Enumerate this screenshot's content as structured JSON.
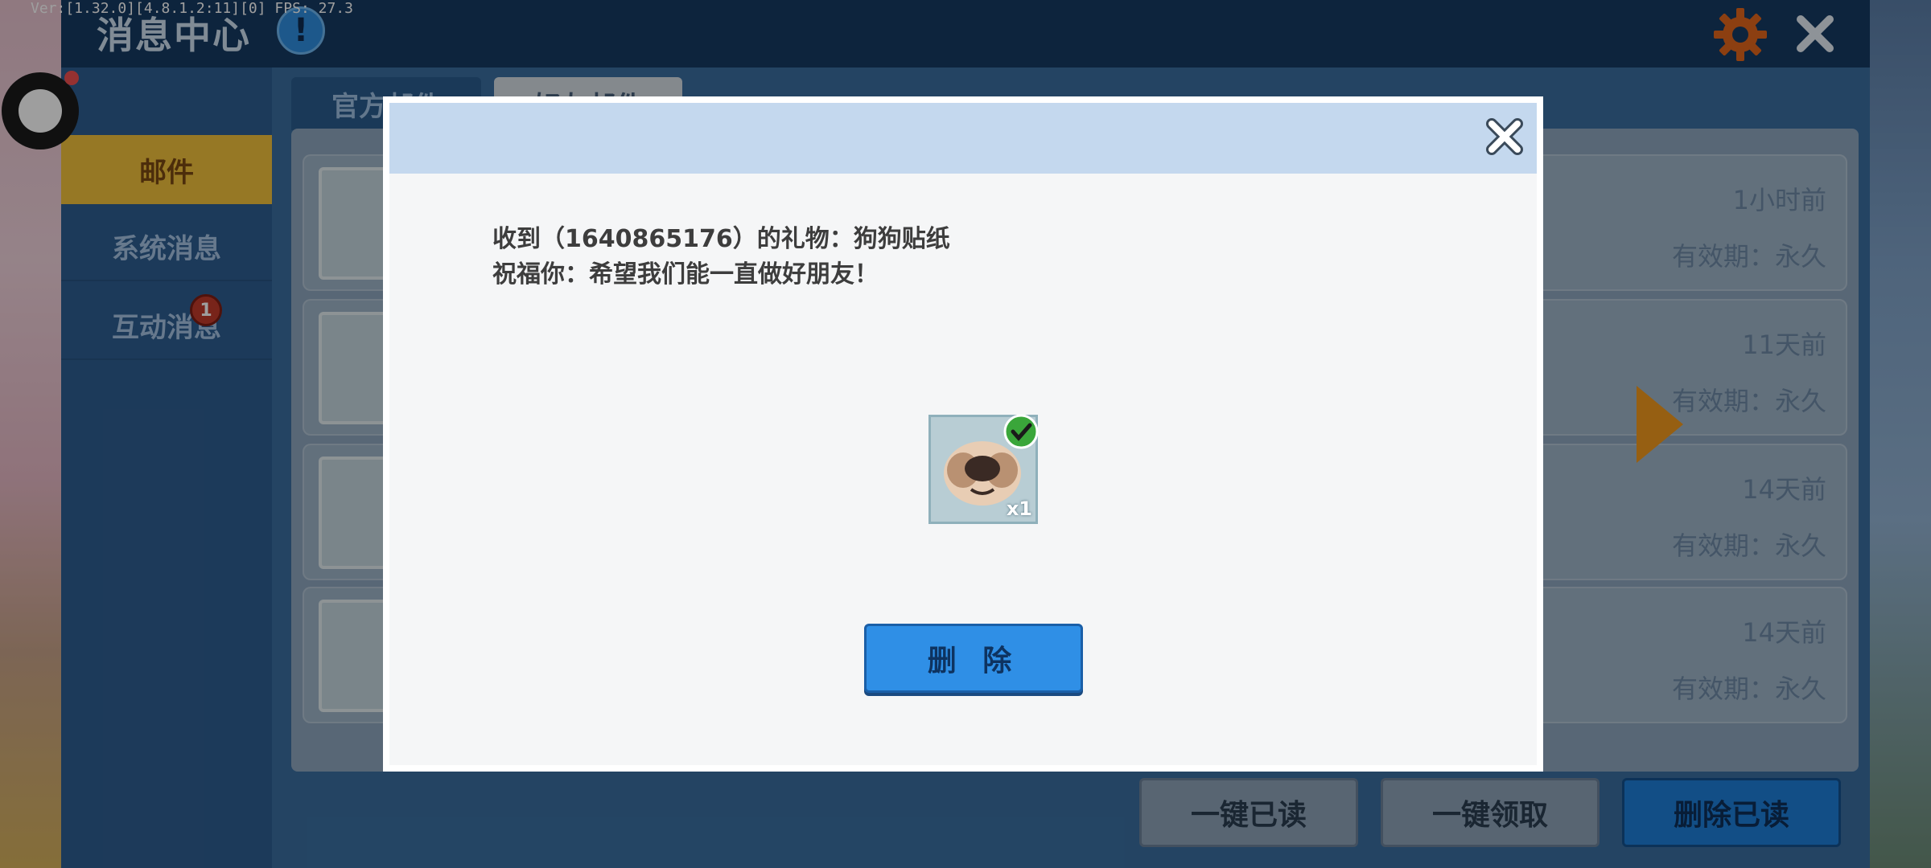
{
  "header": {
    "title": "消息中心",
    "version": "Ver:[1.32.0][4.8.1.2:11][0] FPS: 27.3",
    "info_label": "!"
  },
  "sidebar": {
    "items": [
      {
        "label": "邮件"
      },
      {
        "label": "系统消息"
      },
      {
        "label": "互动消息"
      }
    ],
    "interaction_badge": "1"
  },
  "tabs": [
    {
      "label": "官方邮件"
    },
    {
      "label": "好友邮件"
    }
  ],
  "mail_list": [
    {
      "time": "1小时前",
      "validity": "有效期：永久"
    },
    {
      "time": "11天前",
      "validity": "有效期：永久"
    },
    {
      "time": "14天前",
      "validity": "有效期：永久"
    },
    {
      "time": "14天前",
      "validity": "有效期：永久"
    }
  ],
  "bottom_buttons": {
    "mark_all_read": "一键已读",
    "claim_all": "一键领取",
    "delete_read": "删除已读"
  },
  "dialog": {
    "line1": "收到（1640865176）的礼物：狗狗贴纸",
    "line2": "祝福你：希望我们能一直做好朋友！",
    "item_quantity": "x1",
    "delete_label": "删 除"
  },
  "colors": {
    "accent_orange": "#f39a1e",
    "active_tab_yellow": "#f2c23c",
    "primary_blue": "#2f8fe6"
  }
}
